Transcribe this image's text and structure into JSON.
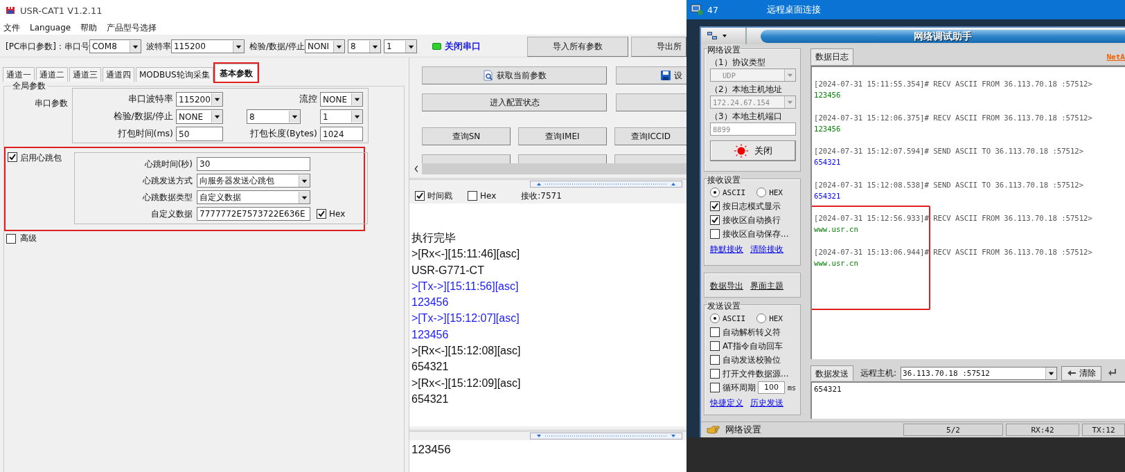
{
  "left_app": {
    "title": "USR-CAT1 V1.2.11",
    "menu": [
      "文件",
      "Language",
      "帮助",
      "产品型号选择"
    ],
    "toolbar": {
      "port_label": "[PC串口参数]：串口号",
      "port": "COM8",
      "baud_label": "波特率",
      "baud": "115200",
      "frame_label": "检验/数据/停止",
      "parity": "NONI",
      "data_bits": "8",
      "stop_bits": "1",
      "serial_open": true,
      "serial_button": "关闭串口",
      "buttons": [
        "导入所有参数",
        "导出所"
      ]
    },
    "tabs": [
      {
        "label": "通道一",
        "selected": false,
        "highlighted": false
      },
      {
        "label": "通道二",
        "selected": false,
        "highlighted": false
      },
      {
        "label": "通道三",
        "selected": false,
        "highlighted": false
      },
      {
        "label": "通道四",
        "selected": false,
        "highlighted": false
      },
      {
        "label": "MODBUS轮询采集",
        "selected": false,
        "highlighted": false
      },
      {
        "label": "基本参数",
        "selected": true,
        "highlighted": true
      }
    ],
    "global": {
      "title": "全局参数",
      "serial_label": "串口参数",
      "rows": [
        [
          {
            "kind": "label",
            "text": "串口波特率"
          },
          {
            "kind": "select",
            "value": "115200"
          },
          {
            "kind": "label",
            "text": "流控"
          },
          {
            "kind": "select",
            "value": "NONE"
          }
        ],
        [
          {
            "kind": "label",
            "text": "检验/数据/停止"
          },
          {
            "kind": "select",
            "value": "NONE"
          },
          {
            "kind": "select",
            "value": "8"
          },
          {
            "kind": "select",
            "value": "1"
          }
        ],
        [
          {
            "kind": "label",
            "text": "打包时间(ms)"
          },
          {
            "kind": "input",
            "value": "50"
          },
          {
            "kind": "label",
            "text": "打包长度(Bytes)"
          },
          {
            "kind": "input",
            "value": "1024"
          }
        ]
      ]
    },
    "heartbeat": {
      "label": "启用心跳包",
      "checked": true,
      "highlighted": true,
      "fields": [
        {
          "label": "心跳时间(秒)",
          "kind": "input",
          "value": "30"
        },
        {
          "label": "心跳发送方式",
          "kind": "select",
          "value": "向服务器发送心跳包"
        },
        {
          "label": "心跳数据类型",
          "kind": "select",
          "value": "自定义数据"
        },
        {
          "label": "自定义数据",
          "kind": "input",
          "value": "7777772E7573722E636E"
        }
      ],
      "hex": {
        "label": "Hex",
        "checked": true
      }
    },
    "advanced": {
      "label": "高级",
      "checked": false
    },
    "action_rows": [
      [
        {
          "label": "获取当前参数"
        },
        {
          "label": "设"
        }
      ],
      [
        {
          "label": "进入配置状态"
        }
      ]
    ],
    "queries": [
      "查询SN",
      "查询IMEI",
      "查询ICCID"
    ],
    "log_options": {
      "timestamp": {
        "label": "时间戳",
        "checked": true
      },
      "hex": {
        "label": "Hex",
        "checked": false
      },
      "rx_count": "接收:7571"
    },
    "log": [
      {
        "kind": "info",
        "text": "执行完毕"
      },
      {
        "kind": "rx",
        "text": ">[Rx<-][15:11:46][asc]"
      },
      {
        "kind": "rx",
        "text": "USR-G771-CT"
      },
      {
        "kind": "tx",
        "text": ">[Tx->][15:11:56][asc]"
      },
      {
        "kind": "tx",
        "text": "123456"
      },
      {
        "kind": "tx",
        "text": ">[Tx->][15:12:07][asc]"
      },
      {
        "kind": "tx",
        "text": "123456"
      },
      {
        "kind": "rx",
        "text": ">[Rx<-][15:12:08][asc]"
      },
      {
        "kind": "rx",
        "text": "654321"
      },
      {
        "kind": "rx",
        "text": ">[Rx<-][15:12:09][asc]"
      },
      {
        "kind": "rx",
        "text": "654321"
      }
    ],
    "input": "123456"
  },
  "remote": {
    "title_prefix": "47",
    "title": "远程桌面连接",
    "app_title": "网络调试助手",
    "net": {
      "title": "网络设置",
      "protocol_label": "（1）协议类型",
      "protocol": "UDP",
      "host_label": "（2）本地主机地址",
      "host": "172.24.67.154",
      "port_label": "（3）本地主机端口",
      "port": "8899",
      "close_button": "关闭"
    },
    "recv": {
      "title": "接收设置",
      "modes": [
        {
          "label": "ASCII",
          "selected": true
        },
        {
          "label": "HEX",
          "selected": false
        }
      ],
      "options": [
        {
          "label": "按日志模式显示",
          "checked": true
        },
        {
          "label": "接收区自动换行",
          "checked": true
        },
        {
          "label": "接收区自动保存...",
          "checked": false
        }
      ],
      "links": [
        "静默接收",
        "清除接收"
      ]
    },
    "extra_links": [
      "数据导出",
      "界面主题"
    ],
    "send": {
      "title": "发送设置",
      "modes": [
        {
          "label": "ASCII",
          "selected": true
        },
        {
          "label": "HEX",
          "selected": false
        }
      ],
      "options": [
        {
          "label": "自动解析转义符",
          "checked": false
        },
        {
          "label": "AT指令自动回车",
          "checked": false
        },
        {
          "label": "自动发送校验位",
          "checked": false
        },
        {
          "label": "打开文件数据源...",
          "checked": false
        }
      ],
      "cycle": {
        "label": "循环周期",
        "checked": false,
        "value": "100",
        "unit": "ms"
      },
      "links": [
        "快捷定义",
        "历史发送"
      ]
    },
    "log_tab": "数据日志",
    "brand_link": "NetA",
    "log": [
      {
        "kind": "recv",
        "header": "[2024-07-31 15:11:55.354]# RECV ASCII FROM 36.113.70.18 :57512>",
        "value": "123456",
        "highlighted": false
      },
      {
        "kind": "recv",
        "header": "[2024-07-31 15:12:06.375]# RECV ASCII FROM 36.113.70.18 :57512>",
        "value": "123456",
        "highlighted": false
      },
      {
        "kind": "send",
        "header": "[2024-07-31 15:12:07.594]# SEND ASCII TO 36.113.70.18 :57512>",
        "value": "654321",
        "highlighted": false
      },
      {
        "kind": "send",
        "header": "[2024-07-31 15:12:08.538]# SEND ASCII TO 36.113.70.18 :57512>",
        "value": "654321",
        "highlighted": false
      },
      {
        "kind": "recv",
        "header": "[2024-07-31 15:12:56.933]# RECV ASCII FROM 36.113.70.18 :57512>",
        "value": "www.usr.cn",
        "highlighted": true
      },
      {
        "kind": "recv",
        "header": "[2024-07-31 15:13:06.944]# RECV ASCII FROM 36.113.70.18 :57512>",
        "value": "www.usr.cn",
        "highlighted": true
      }
    ],
    "send_bar": {
      "tab": "数据发送",
      "remote_label": "远程主机:",
      "remote": "36.113.70.18 :57512",
      "clear_button": "清除",
      "text": "654321"
    },
    "status": {
      "label": "网络设置",
      "cells": [
        "5/2",
        "RX:42",
        "TX:12"
      ]
    }
  }
}
